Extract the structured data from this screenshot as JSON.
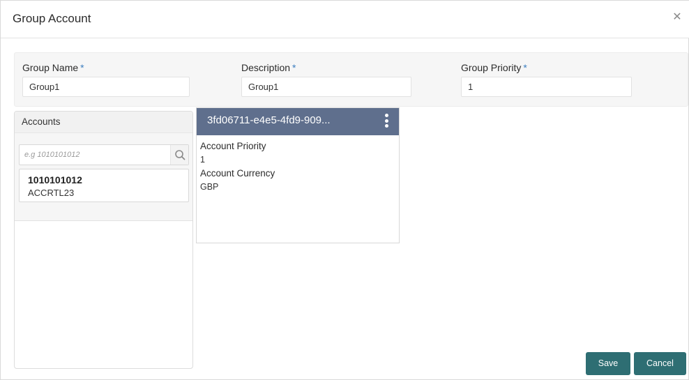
{
  "dialog": {
    "title": "Group Account",
    "close_icon": "close-icon"
  },
  "fields": {
    "group_name": {
      "label": "Group Name",
      "required": "*",
      "value": "Group1"
    },
    "description": {
      "label": "Description",
      "required": "*",
      "value": "Group1"
    },
    "group_priority": {
      "label": "Group Priority",
      "required": "*",
      "value": "1"
    }
  },
  "accounts": {
    "title": "Accounts",
    "search_placeholder": "e.g 1010101012",
    "items": [
      {
        "number": "1010101012",
        "name": "ACCRTL23"
      }
    ]
  },
  "group_card": {
    "title": "3fd06711-e4e5-4fd9-909...",
    "menu_icon": "more-vertical-icon",
    "account_priority_label": "Account Priority",
    "account_priority_value": "1",
    "account_currency_label": "Account Currency",
    "account_currency_value": "GBP"
  },
  "footer": {
    "save_label": "Save",
    "cancel_label": "Cancel"
  },
  "colors": {
    "accent": "#2e6e73",
    "card_header": "#5f6f8d",
    "required": "#3b7dbf"
  }
}
